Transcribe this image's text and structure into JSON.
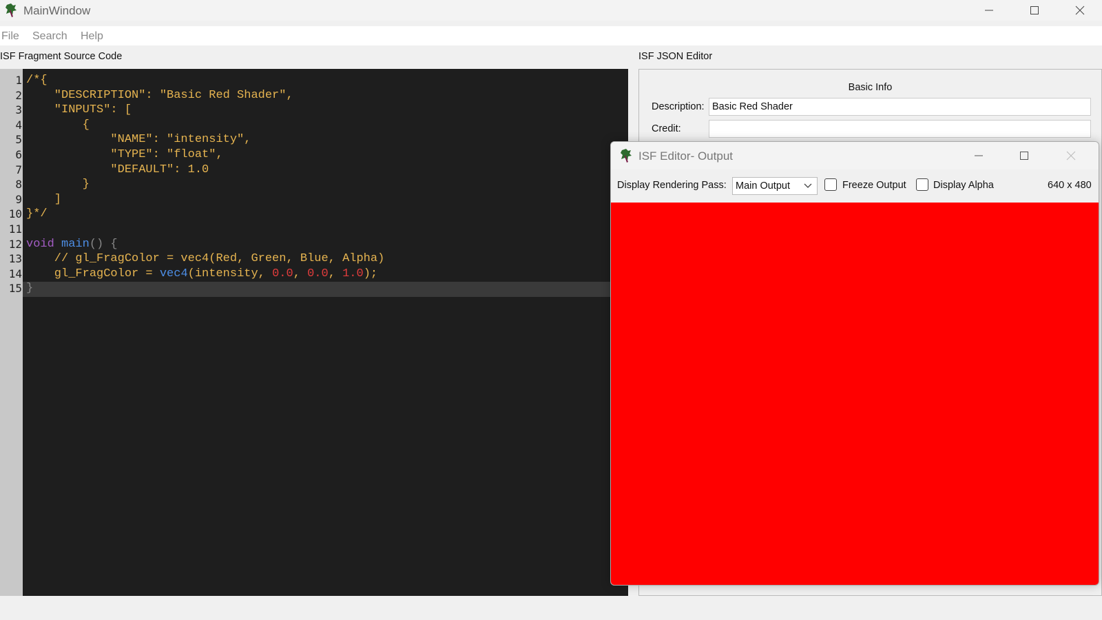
{
  "main_window": {
    "title": "MainWindow",
    "menu": [
      "File",
      "Search",
      "Help"
    ]
  },
  "source_pane": {
    "label": "ISF Fragment Source Code",
    "line_numbers": [
      "1",
      "2",
      "3",
      "4",
      "5",
      "6",
      "7",
      "8",
      "9",
      "10",
      "11",
      "12",
      "13",
      "14",
      "15"
    ],
    "lines": [
      "/*{",
      "    \"DESCRIPTION\": \"Basic Red Shader\",",
      "    \"INPUTS\": [",
      "        {",
      "            \"NAME\": \"intensity\",",
      "            \"TYPE\": \"float\",",
      "            \"DEFAULT\": 1.0",
      "        }",
      "    ]",
      "}*/",
      "",
      "void main() {",
      "    // gl_FragColor = vec4(Red, Green, Blue, Alpha)",
      "    gl_FragColor = vec4(intensity, 0.0, 0.0, 1.0);",
      "}"
    ],
    "tokens": {
      "void": "void",
      "main": " main",
      "main_rest": "() {",
      "l14_a": "    gl_FragColor = ",
      "l14_vec4": "vec4",
      "l14_b": "(intensity, ",
      "l14_n1": "0.0",
      "l14_c1": ", ",
      "l14_n2": "0.0",
      "l14_c2": ", ",
      "l14_n3": "1.0",
      "l14_end": ");"
    }
  },
  "json_editor": {
    "label": "ISF JSON Editor",
    "section_title": "Basic Info",
    "description_label": "Description:",
    "description_value": "Basic Red Shader",
    "credit_label": "Credit:",
    "credit_value": ""
  },
  "output_window": {
    "title": "ISF Editor- Output",
    "pass_label": "Display Rendering Pass:",
    "pass_value": "Main Output",
    "freeze_label": "Freeze Output",
    "freeze_checked": false,
    "alpha_label": "Display Alpha",
    "alpha_checked": false,
    "resolution": "640 x 480",
    "render_color": "#ff0000"
  },
  "icons": [
    "app-icon",
    "minimize-icon",
    "maximize-icon",
    "close-icon",
    "chevron-down-icon"
  ]
}
